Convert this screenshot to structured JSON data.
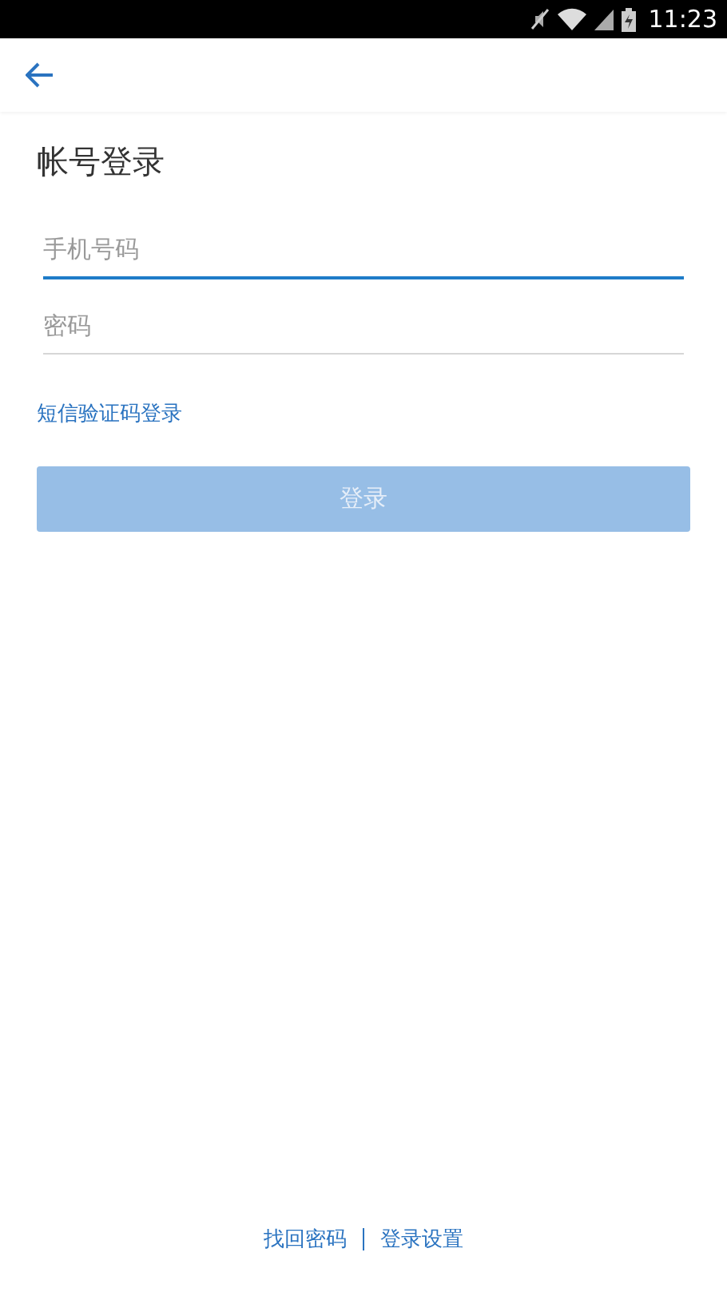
{
  "status_bar": {
    "time": "11:23"
  },
  "title": "帐号登录",
  "fields": [
    {
      "placeholder": "手机号码",
      "focused": true
    },
    {
      "placeholder": "密码",
      "focused": false
    }
  ],
  "sms_login_link": "短信验证码登录",
  "login_button": {
    "label": "登录",
    "disabled": true
  },
  "footer_links": [
    "找回密码",
    "登录设置"
  ]
}
